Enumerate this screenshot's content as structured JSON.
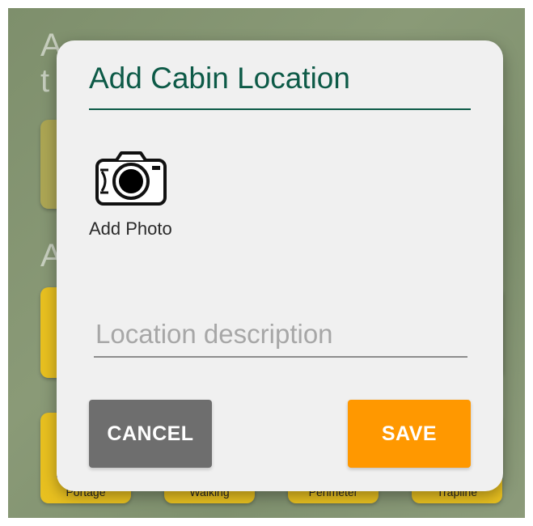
{
  "dialog": {
    "title": "Add Cabin Location",
    "photo_label": "Add Photo",
    "description_placeholder": "Location description",
    "description_value": "",
    "cancel_label": "CANCEL",
    "save_label": "SAVE"
  },
  "background": {
    "tiles": [
      {
        "label": "Portage"
      },
      {
        "label": "Walking"
      },
      {
        "label": "Perimeter"
      },
      {
        "label": "Trapline"
      }
    ]
  },
  "colors": {
    "title": "#0d5a47",
    "dialog_bg": "#f0f0f0",
    "cancel_button": "#6e6e6e",
    "save_button": "#ff9800",
    "tile": "#e8c020"
  },
  "icons": {
    "photo": "camera-icon"
  }
}
